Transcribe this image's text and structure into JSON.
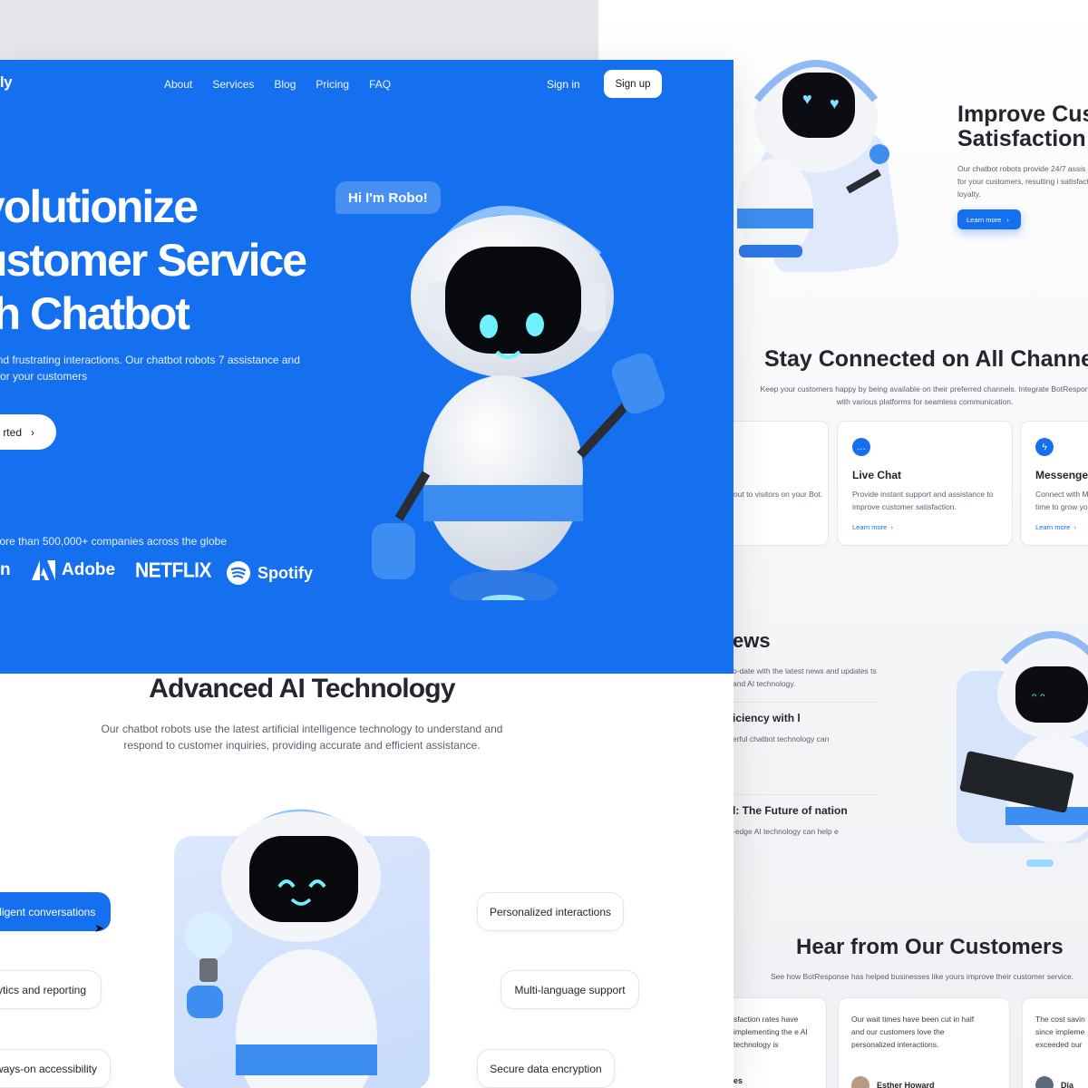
{
  "colors": {
    "brand": "#1570ef",
    "text": "#23262f",
    "muted": "#5a6070"
  },
  "nav": {
    "logo": "oly",
    "links": [
      "About",
      "Services",
      "Blog",
      "Pricing",
      "FAQ"
    ],
    "signin": "Sign in",
    "signup": "Sign up"
  },
  "hero": {
    "title": "volutionize\nustomer Service\nth Chatbot",
    "desc": "e to long wait times and frustrating interactions. Our chatbot robots 7 assistance and personalized service for your customers",
    "cta": "rted",
    "bubble": "Hi I'm Robo!",
    "trusted": "nore than 500,000+ companies across the globe",
    "brands": [
      "n",
      "Adobe",
      "NETFLIX",
      "Spotify"
    ]
  },
  "ai": {
    "title": "Advanced AI Technology",
    "desc": "Our chatbot robots use the latest artificial intelligence technology to understand and respond to customer inquiries, providing accurate and efficient assistance.",
    "features": [
      "lligent conversations",
      "ytics and reporting",
      "ways-on accessibility",
      "Personalized interactions",
      "Multi-language support",
      "Secure data encryption"
    ]
  },
  "satisfaction": {
    "title": "Improve Cust\nSatisfaction",
    "desc": "Our chatbot robots provide 24/7 assis service for your customers, resulting i satisfaction and loyalty.",
    "button": "Learn more"
  },
  "channels": {
    "title": "Stay Connected on All Channels",
    "desc": "Keep your customers happy by being available on their preferred channels. Integrate BotRespon with various platforms for seamless communication.",
    "cards": [
      {
        "title": "",
        "desc": "out to visitors on your Bot.",
        "link": ""
      },
      {
        "title": "Live Chat",
        "desc": "Provide instant support and assistance to improve customer satisfaction.",
        "link": "Learn more"
      },
      {
        "title": "Messenge",
        "desc": "Connect with M time to grow yo",
        "link": "Learn more"
      }
    ]
  },
  "news": {
    "title": "ews",
    "desc": "o-date with the latest news and updates ts and AI technology.",
    "items": [
      {
        "title": "iciency with l",
        "desc": "erful chatbot technology can"
      },
      {
        "title": "l: The Future of nation",
        "desc": "-edge AI technology can help e"
      }
    ]
  },
  "customers": {
    "title": "Hear from Our Customers",
    "desc": "See how BotResponse has helped businesses like yours improve their customer service.",
    "testimonials": [
      {
        "text": "sfaction rates have implementing the e AI technology is",
        "name": "es"
      },
      {
        "text": "Our wait times have been cut in half and our customers love the personalized interactions.",
        "name": "Esther Howard"
      },
      {
        "text": "The cost savin since impleme exceeded our",
        "name": "Dia"
      }
    ]
  }
}
